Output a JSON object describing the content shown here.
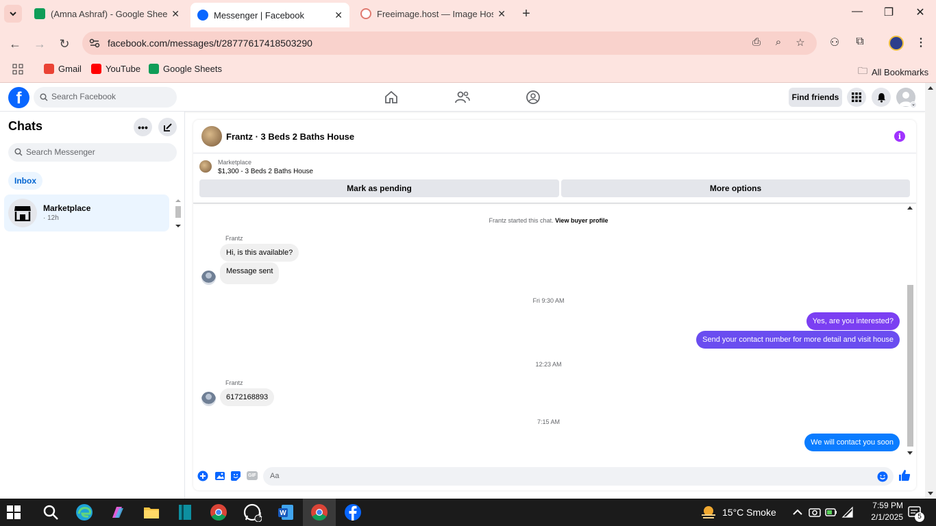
{
  "browser": {
    "tabs": [
      {
        "title": "(Amna Ashraf) - Google Sheets",
        "color": "#0f9d58",
        "active": false
      },
      {
        "title": "Messenger | Facebook",
        "color": "#0866ff",
        "active": true
      },
      {
        "title": "Freeimage.host — Image Hostin",
        "color": "#e07a70",
        "active": false
      }
    ],
    "url": "facebook.com/messages/t/28777617418503290",
    "bookmarks": [
      {
        "label": "Gmail",
        "color": "#ea4335"
      },
      {
        "label": "YouTube",
        "color": "#ff0000"
      },
      {
        "label": "Google Sheets",
        "color": "#0f9d58"
      }
    ],
    "all_bookmarks": "All Bookmarks"
  },
  "fb_header": {
    "logo": "f",
    "search_placeholder": "Search Facebook",
    "find_friends": "Find friends"
  },
  "sidebar": {
    "title": "Chats",
    "search_placeholder": "Search Messenger",
    "filter": "Inbox",
    "chats": [
      {
        "name": "Marketplace",
        "time": "· 12h"
      }
    ]
  },
  "conversation": {
    "title": "Frantz · 3 Beds 2 Baths House",
    "listing": {
      "kind": "Marketplace",
      "title": "$1,300 - 3 Beds 2 Baths House",
      "mark_pending": "Mark as pending",
      "more_options": "More options"
    },
    "system_text": "Frantz started this chat.",
    "system_link": "View buyer profile",
    "messages": [
      {
        "sender": "Frantz",
        "text": "Hi, is this available?"
      },
      {
        "text": "Message sent"
      },
      {
        "stamp": "Fri 9:30 AM"
      },
      {
        "text": "Yes, are you interested?"
      },
      {
        "text": "Send your contact number for more detail and visit house"
      },
      {
        "stamp": "12:23 AM"
      },
      {
        "sender": "Frantz",
        "text": "6172168893"
      },
      {
        "stamp": "7:15 AM"
      },
      {
        "text": "We will contact you soon"
      }
    ],
    "composer_placeholder": "Aa",
    "gif_label": "GIF"
  },
  "colors": {
    "outgoing_purple": "#7b3ff2",
    "outgoing_blue": "#0a7cff",
    "accent": "#0866ff"
  },
  "taskbar": {
    "weather": "15°C  Smoke",
    "time": "7:59 PM",
    "date": "2/1/2025",
    "whatsapp_badge": "1",
    "notif_badge": "5"
  }
}
